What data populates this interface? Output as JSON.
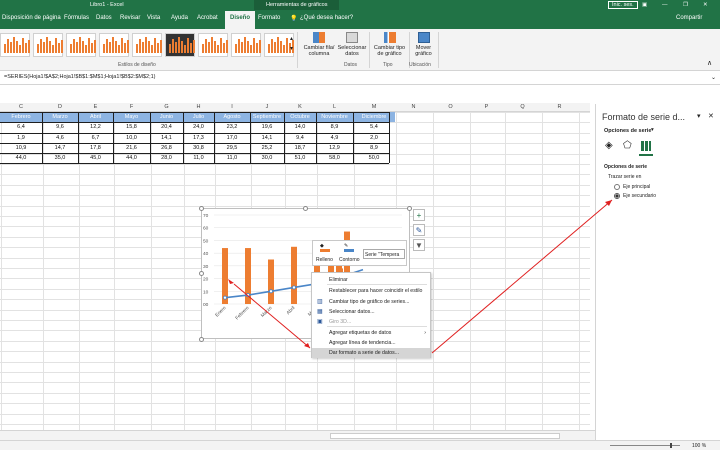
{
  "titlebar": {
    "file": "Libro1 - Excel",
    "tools": "Herramientas de gráficos",
    "user": "Inic. ses."
  },
  "tabs": [
    "Disposición de página",
    "Fórmulas",
    "Datos",
    "Revisar",
    "Vista",
    "Ayuda",
    "Acrobat",
    "Diseño",
    "Formato"
  ],
  "tell_me": "¿Qué desea hacer?",
  "share": "Compartir",
  "ribbon": {
    "styles_group": "Estilos de diseño",
    "switch_row_col": "Cambiar fila/ columna",
    "select_data": "Seleccionar datos",
    "data_group": "Datos",
    "change_chart_type": "Cambiar tipo de gráfico",
    "type_group": "Tipo",
    "move_chart": "Mover gráfico",
    "location_group": "Ubicación"
  },
  "formula": "=SERIES(Hoja1!$A$2;Hoja1!$B$1:$M$1;Hoja1!$B$2:$M$2;1)",
  "columns": [
    "C",
    "D",
    "E",
    "F",
    "G",
    "H",
    "I",
    "J",
    "K",
    "L",
    "M",
    "N",
    "O",
    "P",
    "Q",
    "R"
  ],
  "table": {
    "header": [
      "Febrero",
      "Marzo",
      "Abril",
      "Mayo",
      "Junio",
      "Julio",
      "Agosto",
      "Septiembre",
      "Octubre",
      "Noviembre",
      "Diciembre"
    ],
    "rows": [
      [
        "6,4",
        "9,6",
        "12,2",
        "15,8",
        "20,4",
        "24,0",
        "23,2",
        "19,6",
        "14,0",
        "8,9",
        "5,4"
      ],
      [
        "1,9",
        "4,6",
        "6,7",
        "10,0",
        "14,1",
        "17,3",
        "17,0",
        "14,1",
        "9,4",
        "4,9",
        "2,0"
      ],
      [
        "10,9",
        "14,7",
        "17,8",
        "21,6",
        "26,8",
        "30,8",
        "29,5",
        "25,2",
        "18,7",
        "12,9",
        "8,9"
      ],
      [
        "44,0",
        "35,0",
        "45,0",
        "44,0",
        "28,0",
        "11,0",
        "11,0",
        "30,0",
        "51,0",
        "58,0",
        "50,0"
      ]
    ]
  },
  "chart_data": {
    "type": "bar",
    "categories": [
      "Enero",
      "Febrero",
      "Marzo",
      "Abril",
      "Mayo",
      "Junio"
    ],
    "yticks": [
      "70",
      "60",
      "50",
      "40",
      "30",
      "20",
      "10",
      "00"
    ],
    "ylim": [
      0,
      70
    ],
    "series": [
      {
        "values": [
          44,
          44,
          35,
          45,
          44,
          28
        ],
        "color": "#ed7d31"
      },
      {
        "values": [
          5,
          7,
          10,
          13,
          16,
          21
        ],
        "color": "#4a86c8",
        "kind": "line"
      }
    ]
  },
  "minitoolbar": {
    "fill": "Relleno",
    "outline": "Contorno",
    "series": "Serie \"Tempera"
  },
  "context_menu": [
    {
      "label": "Eliminar",
      "disabled": false
    },
    {
      "label": "Restablecer para hacer coincidir el estilo",
      "disabled": false
    },
    {
      "label": "Cambiar tipo de gráfico de series...",
      "disabled": false
    },
    {
      "label": "Seleccionar datos...",
      "disabled": false
    },
    {
      "label": "Giro 3D...",
      "disabled": true
    },
    {
      "label": "Agregar etiquetas de datos",
      "disabled": false
    },
    {
      "label": "Agregar línea de tendencia...",
      "disabled": false
    },
    {
      "label": "Dar formato a serie de datos...",
      "disabled": false
    }
  ],
  "pane": {
    "title": "Formato de serie d...",
    "options_label": "Opciones de serie",
    "section": "Opciones de serie",
    "plot_on": "Trazar serie en",
    "primary": "Eje principal",
    "secondary": "Eje secundario"
  },
  "status": {
    "zoom": "100 %"
  }
}
